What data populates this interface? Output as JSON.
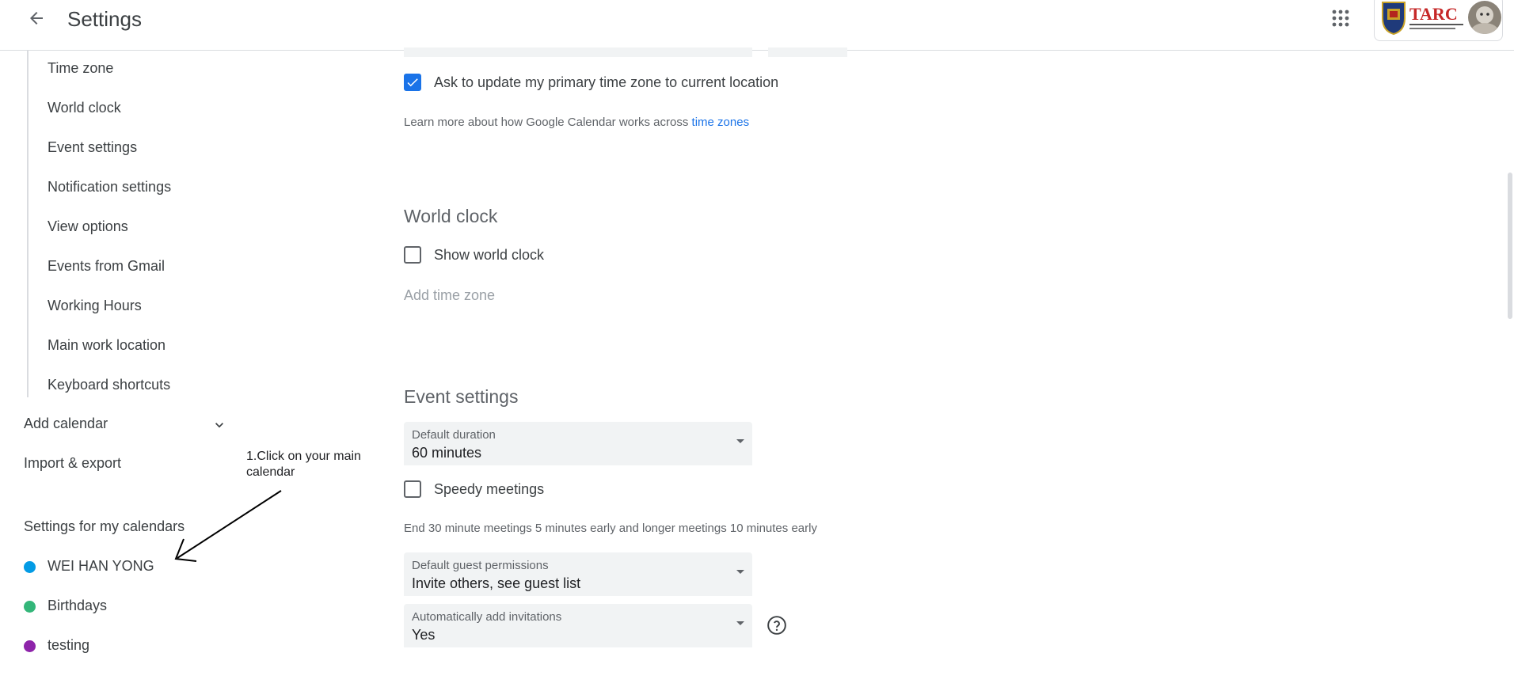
{
  "header": {
    "title": "Settings",
    "back_icon": "arrow-left-icon",
    "apps_icon": "apps-grid-icon",
    "org_logo_text": "TARC"
  },
  "sidebar": {
    "subitems": [
      {
        "label": "Time zone"
      },
      {
        "label": "World clock"
      },
      {
        "label": "Event settings"
      },
      {
        "label": "Notification settings"
      },
      {
        "label": "View options"
      },
      {
        "label": "Events from Gmail"
      },
      {
        "label": "Working Hours"
      },
      {
        "label": "Main work location"
      },
      {
        "label": "Keyboard shortcuts"
      }
    ],
    "add_calendar": "Add calendar",
    "import_export": "Import & export",
    "my_calendars_heading": "Settings for my calendars",
    "calendars": [
      {
        "label": "WEI HAN YONG",
        "color": "#039be5"
      },
      {
        "label": "Birthdays",
        "color": "#33b679"
      },
      {
        "label": "testing",
        "color": "#8e24aa"
      }
    ]
  },
  "annotation": {
    "text": "1.Click on your main calendar"
  },
  "timezone": {
    "update_checkbox_label": "Ask to update my primary time zone to current location",
    "update_checked": true,
    "learn_more_text": "Learn more about how Google Calendar works across ",
    "learn_more_link": "time zones"
  },
  "world_clock": {
    "title": "World clock",
    "show_label": "Show world clock",
    "show_checked": false,
    "add_time_zone": "Add time zone"
  },
  "event_settings": {
    "title": "Event settings",
    "default_duration": {
      "label": "Default duration",
      "value": "60 minutes"
    },
    "speedy_meetings_label": "Speedy meetings",
    "speedy_checked": false,
    "speedy_note": "End 30 minute meetings 5 minutes early and longer meetings 10 minutes early",
    "guest_permissions": {
      "label": "Default guest permissions",
      "value": "Invite others, see guest list"
    },
    "auto_invitations": {
      "label": "Automatically add invitations",
      "value": "Yes"
    },
    "help_icon": "help-circle-icon"
  },
  "colors": {
    "accent": "#1a73e8"
  }
}
